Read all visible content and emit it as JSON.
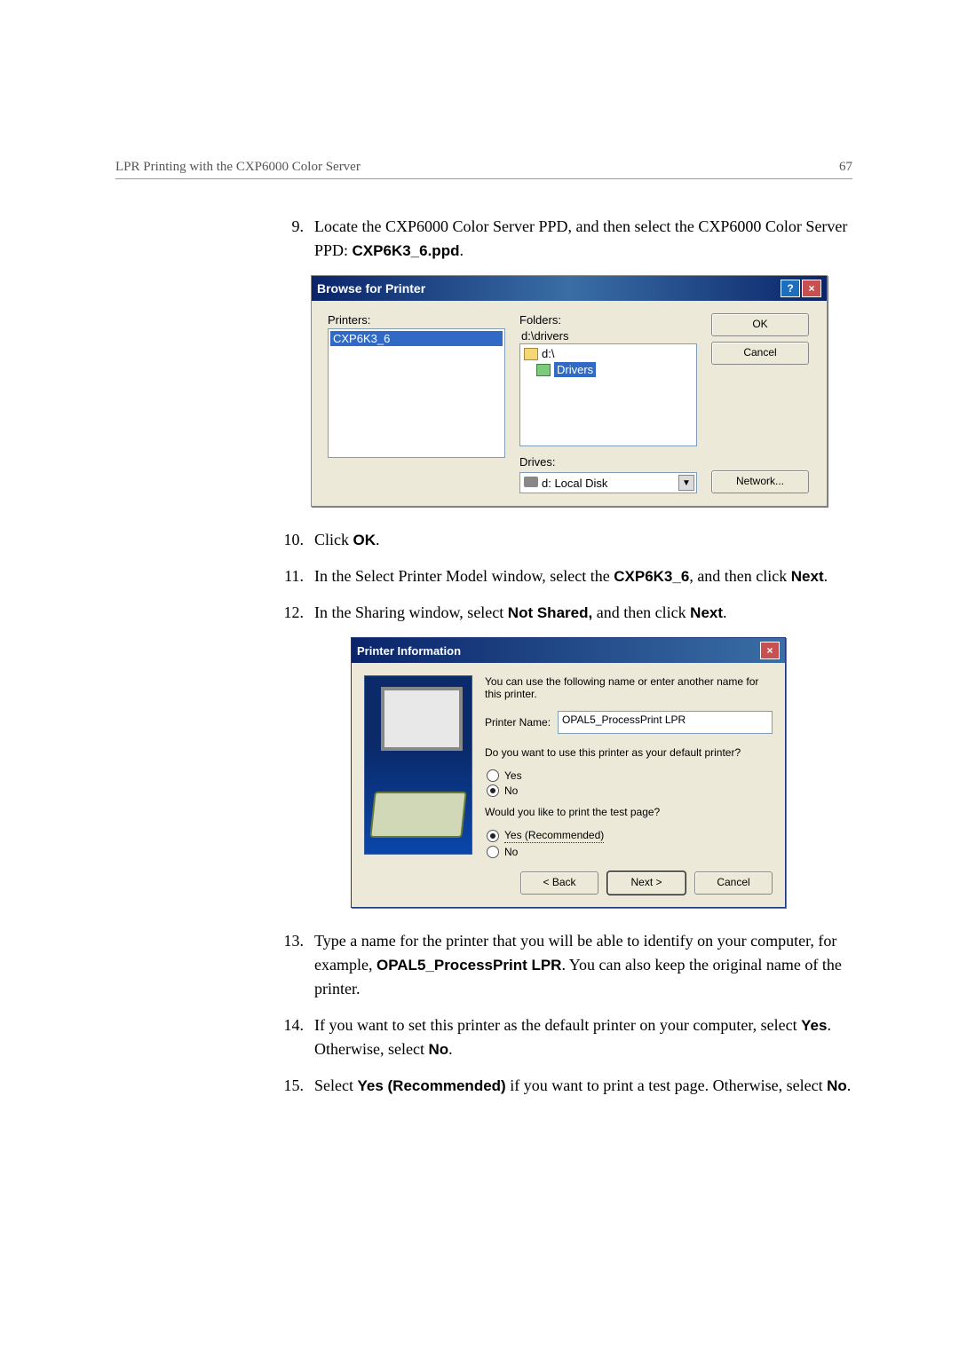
{
  "header": {
    "left": "LPR Printing with the CXP6000 Color Server",
    "right": "67"
  },
  "steps": {
    "9": {
      "num": "9.",
      "text_a": "Locate the CXP6000 Color Server PPD, and then select the CXP6000 Color Server PPD: ",
      "code": "CXP6K3_6.ppd",
      "text_b": "."
    },
    "10": {
      "num": "10.",
      "text_a": "Click ",
      "code": "OK",
      "text_b": "."
    },
    "11": {
      "num": "11.",
      "text_a": "In the Select Printer Model window, select the ",
      "code": "CXP6K3_6",
      "text_b": ", and then click ",
      "code2": "Next",
      "text_c": "."
    },
    "12": {
      "num": "12.",
      "text_a": "In the Sharing window, select ",
      "code": "Not Shared,",
      "text_b": " and then click ",
      "code2": "Next",
      "text_c": "."
    },
    "13": {
      "num": "13.",
      "text_a": "Type a name for the printer that you will be able to identify on your computer, for example, ",
      "code": "OPAL5_ProcessPrint LPR",
      "text_b": ". You can also keep the original name of the printer."
    },
    "14": {
      "num": "14.",
      "text_a": "If you want to set this printer as the default printer on your computer, select ",
      "code": "Yes",
      "text_b": ". Otherwise, select ",
      "code2": "No",
      "text_c": "."
    },
    "15": {
      "num": "15.",
      "text_a": "Select ",
      "code": "Yes (Recommended)",
      "text_b": " if you want to print a test page. Otherwise, select ",
      "code2": "No",
      "text_c": "."
    }
  },
  "dialog1": {
    "title": "Browse for Printer",
    "printers_label": "Printers:",
    "printer_item": "CXP6K3_6",
    "folders_label": "Folders:",
    "folder_path": "d:\\drivers",
    "tree_d": "d:\\",
    "tree_drivers": "Drivers",
    "drives_label": "Drives:",
    "drive_val": "d: Local Disk",
    "ok": "OK",
    "cancel": "Cancel",
    "network": "Network..."
  },
  "dialog2": {
    "title": "Printer Information",
    "intro": "You can use the following name or enter another name for this printer.",
    "pn_label": "Printer Name:",
    "pn_value": "OPAL5_ProcessPrint LPR",
    "q1": "Do you want to use this printer as your default printer?",
    "yes": "Yes",
    "no": "No",
    "q2": "Would you like to print the test page?",
    "yes_rec": "Yes (Recommended)",
    "no2": "No",
    "back": "< Back",
    "next": "Next >",
    "cancel": "Cancel"
  }
}
